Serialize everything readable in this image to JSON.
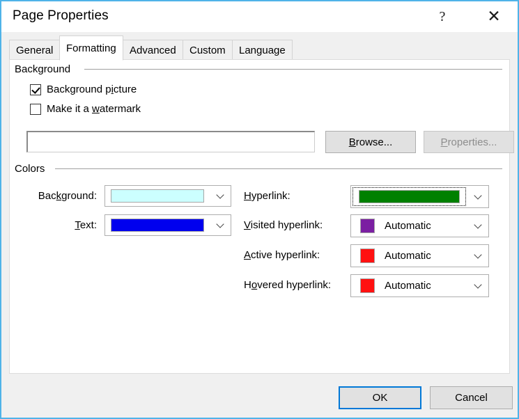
{
  "window": {
    "title": "Page Properties",
    "help_glyph": "?",
    "close_glyph": "✕",
    "border_color": "#4fb3e8"
  },
  "tabs": [
    {
      "label": "General",
      "active": false
    },
    {
      "label": "Formatting",
      "active": true
    },
    {
      "label": "Advanced",
      "active": false
    },
    {
      "label": "Custom",
      "active": false
    },
    {
      "label": "Language",
      "active": false
    }
  ],
  "background_group": {
    "title": "Background",
    "checkboxes": [
      {
        "label_pre": "Background p",
        "label_accel": "i",
        "label_post": "cture",
        "checked": true
      },
      {
        "label_pre": "Make it a ",
        "label_accel": "w",
        "label_post": "atermark",
        "checked": false
      }
    ],
    "picture_path": "",
    "picture_placeholder": "",
    "browse_pre": "",
    "browse_accel": "B",
    "browse_post": "rowse...",
    "properties_pre": "",
    "properties_accel": "P",
    "properties_post": "roperties...",
    "properties_disabled": true
  },
  "colors_group": {
    "title": "Colors",
    "left_fields": [
      {
        "label_pre": "Bac",
        "label_accel": "k",
        "label_post": "ground:",
        "style": "wide-swatch",
        "swatch_color": "#ccffff",
        "value_text": "",
        "focused": false
      },
      {
        "label_pre": "",
        "label_accel": "T",
        "label_post": "ext:",
        "style": "wide-swatch",
        "swatch_color": "#0000ee",
        "value_text": "",
        "focused": false
      }
    ],
    "right_fields": [
      {
        "label_pre": "",
        "label_accel": "H",
        "label_post": "yperlink:",
        "style": "wide-swatch",
        "swatch_color": "#008000",
        "value_text": "",
        "focused": true
      },
      {
        "label_pre": "",
        "label_accel": "V",
        "label_post": "isited hyperlink:",
        "style": "square-swatch",
        "swatch_color": "#7b1fa2",
        "value_text": "Automatic",
        "focused": false
      },
      {
        "label_pre": "",
        "label_accel": "A",
        "label_post": "ctive hyperlink:",
        "style": "square-swatch",
        "swatch_color": "#ff1111",
        "value_text": "Automatic",
        "focused": false
      },
      {
        "label_pre": "H",
        "label_accel": "o",
        "label_post": "vered hyperlink:",
        "style": "square-swatch",
        "swatch_color": "#ff1111",
        "value_text": "Automatic",
        "focused": false
      }
    ]
  },
  "footer": {
    "ok_label": "OK",
    "cancel_label": "Cancel",
    "default_button": "OK",
    "accent_color": "#0078d7"
  }
}
